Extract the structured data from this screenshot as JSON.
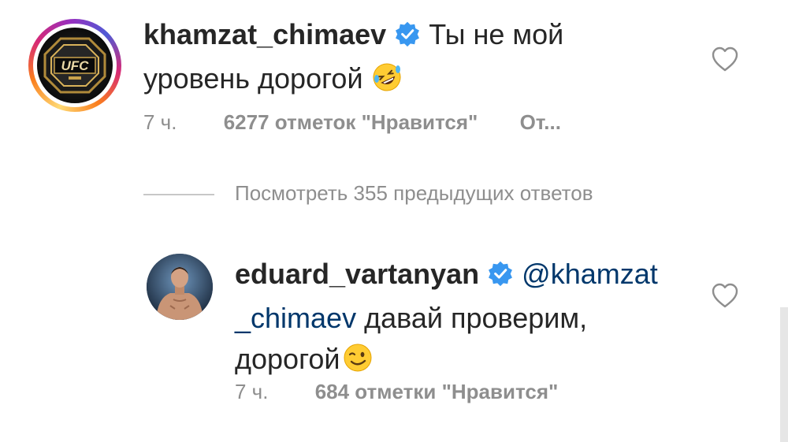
{
  "comments": [
    {
      "username": "khamzat_chimaev",
      "verified": true,
      "text_line1": "Ты не мой",
      "text_line2": "уровень дорогой",
      "emoji": "rolling-on-floor-laughing-emoji",
      "time": "7 ч.",
      "likes": "6277 отметок \"Нравится\"",
      "reply": "От...",
      "avatar": "ufc-belt-logo",
      "avatar_logo_text": "UFC"
    },
    {
      "username": "eduard_vartanyan",
      "verified": true,
      "mention_part1": "@khamzat",
      "mention_part2": "_chimaev",
      "text_line2_rest": " давай проверим,",
      "text_line3": "дорогой",
      "emoji": "winking-face-emoji",
      "time": "7 ч.",
      "likes": "684 отметки \"Нравится\"",
      "avatar": "fighter-photo"
    }
  ],
  "view_replies": "Посмотреть 355 предыдущих ответов",
  "colors": {
    "text": "#262626",
    "meta": "#8e8e8e",
    "verified": "#3897f0",
    "mention": "#00376b"
  }
}
